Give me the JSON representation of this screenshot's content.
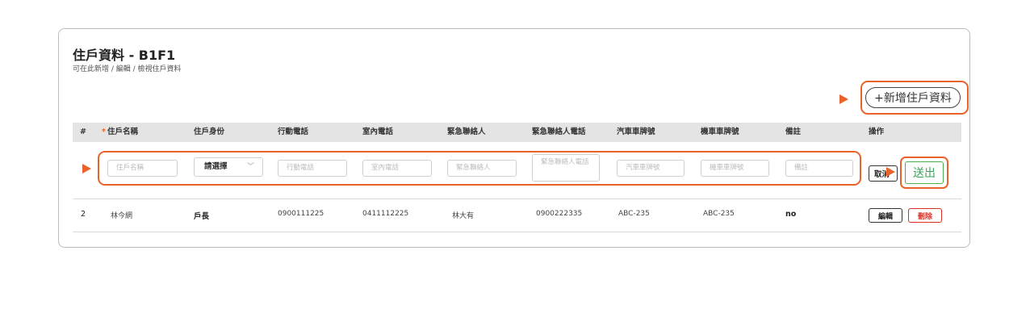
{
  "header": {
    "title": "住戶資料 - B1F1",
    "subtitle": "可在此新增 / 編輯 / 檢視住戶資料"
  },
  "actions": {
    "add_label": "+新增住戶資料"
  },
  "table": {
    "columns": [
      "#",
      "住戶名稱",
      "住戶身份",
      "行動電話",
      "室內電話",
      "緊急聯絡人",
      "緊急聯絡人電話",
      "汽車車牌號",
      "機車車牌號",
      "備註",
      "操作"
    ],
    "required_mark": "*",
    "new_row": {
      "name_placeholder": "住戶名稱",
      "identity_value": "請選擇",
      "mobile_placeholder": "行動電話",
      "home_phone_placeholder": "室內電話",
      "emergency_contact_placeholder": "緊急聯絡人",
      "emergency_phone_placeholder": "緊急聯絡人電話",
      "car_plate_placeholder": "汽車車牌號",
      "scooter_plate_placeholder": "機車車牌號",
      "note_placeholder": "備註",
      "cancel_label": "取消",
      "submit_label": "送出"
    },
    "rows": [
      {
        "no": "2",
        "name": "林今網",
        "identity": "戶長",
        "mobile": "0900111225",
        "home_phone": "0411112225",
        "emergency_contact": "林大有",
        "emergency_phone": "0900222335",
        "car_plate": "ABC-235",
        "scooter_plate": "ABC-235",
        "note": "no",
        "edit_label": "編輯",
        "delete_label": "刪除"
      }
    ]
  },
  "colors": {
    "highlight": "#e8622a",
    "submit": "#3aa55a",
    "delete": "#d93025",
    "header_bg": "#e4e4e4"
  }
}
